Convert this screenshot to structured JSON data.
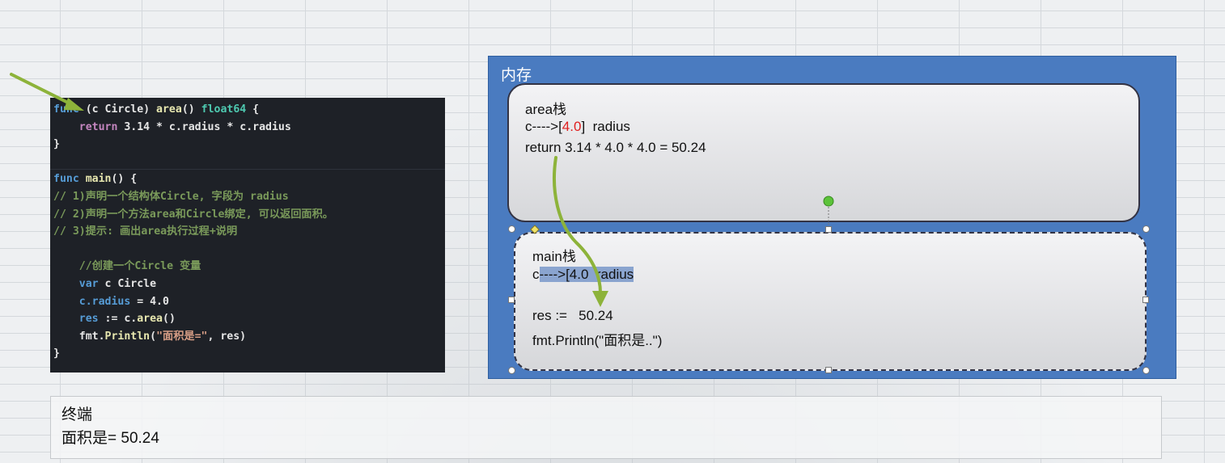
{
  "code": {
    "lines": [
      [
        {
          "t": "func",
          "c": "kw"
        },
        {
          "t": " (c Circle) ",
          "c": "pl"
        },
        {
          "t": "area",
          "c": "fn"
        },
        {
          "t": "() ",
          "c": "pl"
        },
        {
          "t": "float64",
          "c": "ty"
        },
        {
          "t": " {",
          "c": "pl"
        }
      ],
      [
        {
          "t": "    ",
          "c": "pl"
        },
        {
          "t": "return",
          "c": "kw2"
        },
        {
          "t": " 3.14 * c.radius * c.radius",
          "c": "pl"
        }
      ],
      [
        {
          "t": "}",
          "c": "pl"
        }
      ],
      [],
      [
        {
          "t": "func",
          "c": "kw"
        },
        {
          "t": " ",
          "c": "pl"
        },
        {
          "t": "main",
          "c": "fn"
        },
        {
          "t": "() {",
          "c": "pl"
        }
      ],
      [
        {
          "t": "// 1)声明一个结构体Circle, 字段为 radius",
          "c": "cm"
        }
      ],
      [
        {
          "t": "// 2)声明一个方法area和Circle绑定, 可以返回面积。",
          "c": "cm"
        }
      ],
      [
        {
          "t": "// 3)提示: 画出area执行过程+说明",
          "c": "cm"
        }
      ],
      [],
      [
        {
          "t": "    //创建一个Circle 变量",
          "c": "cm"
        }
      ],
      [
        {
          "t": "    ",
          "c": "pl"
        },
        {
          "t": "var",
          "c": "kw"
        },
        {
          "t": " c Circle",
          "c": "pl"
        }
      ],
      [
        {
          "t": "    ",
          "c": "pl"
        },
        {
          "t": "c.radius",
          "c": "kw"
        },
        {
          "t": " = 4.0",
          "c": "pl"
        }
      ],
      [
        {
          "t": "    ",
          "c": "pl"
        },
        {
          "t": "res",
          "c": "kw"
        },
        {
          "t": " := c.",
          "c": "pl"
        },
        {
          "t": "area",
          "c": "fn"
        },
        {
          "t": "()",
          "c": "pl"
        }
      ],
      [
        {
          "t": "    fmt.",
          "c": "pl"
        },
        {
          "t": "Println",
          "c": "fn"
        },
        {
          "t": "(",
          "c": "pl"
        },
        {
          "t": "\"面积是=\"",
          "c": "st"
        },
        {
          "t": ", res)",
          "c": "pl"
        }
      ],
      [
        {
          "t": "}",
          "c": "pl"
        }
      ]
    ]
  },
  "memory": {
    "title": "内存",
    "area_stack": {
      "title": "area栈",
      "c_prefix": "c---->[",
      "c_value": "4.0",
      "c_suffix": "]  radius",
      "return_line": "return 3.14 * 4.0 * 4.0 = 50.24"
    },
    "main_stack": {
      "title": "main栈",
      "c_prefix": "c",
      "c_highlight": "---->[4.0  radius",
      "res_line": "res :=   50.24",
      "println_line": "fmt.Println(\"面积是..\")"
    }
  },
  "terminal": {
    "title": "终端",
    "output": "面积是= 50.24"
  },
  "colors": {
    "arrow": "#8db33a",
    "memory_bg": "#4a7bc0",
    "code_bg": "#1e2127",
    "handle_rotate": "#5cc33a",
    "handle_adjust": "#f2e46a"
  }
}
